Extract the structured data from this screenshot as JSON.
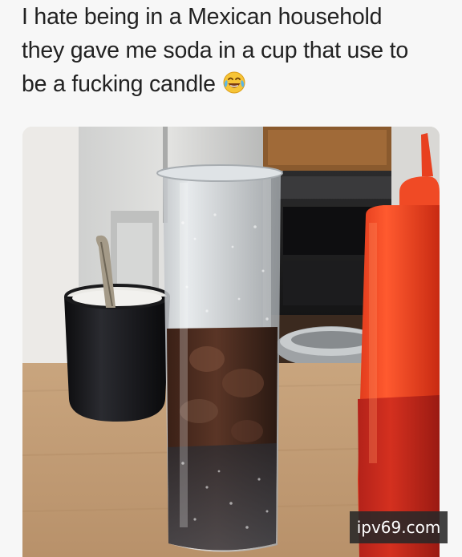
{
  "caption": {
    "line1": "I hate being in a Mexican household",
    "line2": "they gave me soda in a cup that use to",
    "line3": "be a fucking candle"
  },
  "emoji": {
    "name": "face-with-tears-of-joy-icon"
  },
  "watermark": {
    "text": "ipv69.com"
  }
}
